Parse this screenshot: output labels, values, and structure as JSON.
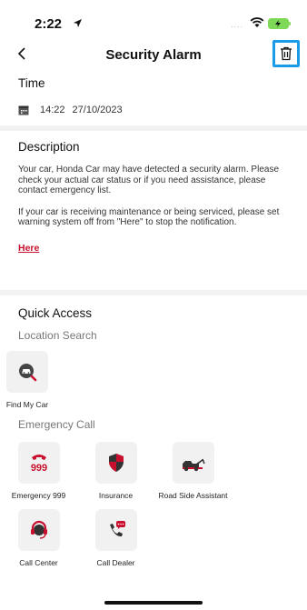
{
  "status_bar": {
    "time": "2:22",
    "signal": "...."
  },
  "nav": {
    "title": "Security Alarm"
  },
  "time_section": {
    "title": "Time",
    "time": "14:22",
    "date": "27/10/2023"
  },
  "description": {
    "title": "Description",
    "paragraph1": "Your car, Honda Car may have detected a security alarm. Please check your actual car status or if you need assistance, please contact emergency list.",
    "paragraph2": "If your car is receiving maintenance or being serviced, please set warning system off from \"Here\" to stop the notification.",
    "link": "Here"
  },
  "quick_access": {
    "title": "Quick Access",
    "location_title": "Location Search",
    "location_items": [
      {
        "label": "Find My Car",
        "icon": "find-car-icon"
      }
    ],
    "emergency_title": "Emergency Call",
    "emergency_items": [
      {
        "label": "Emergency 999",
        "icon": "emergency-999-icon"
      },
      {
        "label": "Insurance",
        "icon": "shield-icon"
      },
      {
        "label": "Road Side Assistant",
        "icon": "tow-truck-icon"
      },
      {
        "label": "Call Center",
        "icon": "headset-icon"
      },
      {
        "label": "Call Dealer",
        "icon": "phone-chat-icon"
      }
    ]
  },
  "colors": {
    "accent": "#c8102e",
    "highlight": "#1a9be8"
  }
}
